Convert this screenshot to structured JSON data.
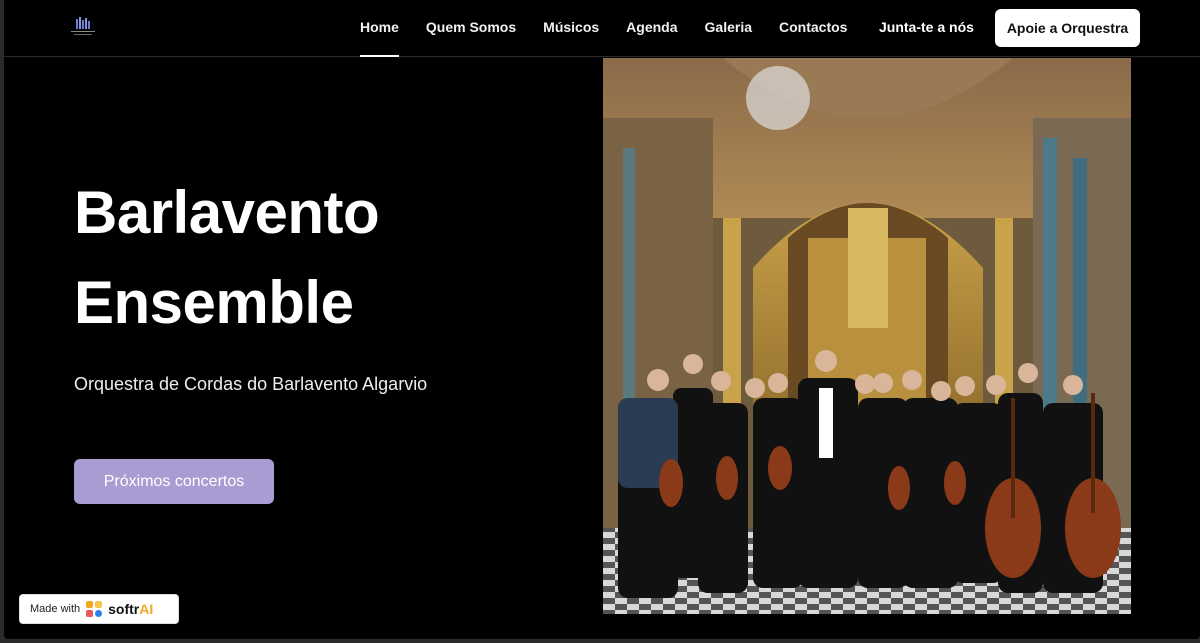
{
  "nav": {
    "items": [
      {
        "label": "Home",
        "active": true
      },
      {
        "label": "Quem Somos",
        "active": false
      },
      {
        "label": "Músicos",
        "active": false
      },
      {
        "label": "Agenda",
        "active": false
      },
      {
        "label": "Galeria",
        "active": false
      },
      {
        "label": "Contactos",
        "active": false
      }
    ],
    "join_label": "Junta-te a nós",
    "support_label": "Apoie a Orquestra"
  },
  "hero": {
    "title_line1": "Barlavento",
    "title_line2": "Ensemble",
    "subtitle": "Orquestra de Cordas do Barlavento Algarvio",
    "cta_label": "Próximos concertos",
    "cta_color": "#a99cd2"
  },
  "badge": {
    "made_with": "Made with",
    "brand": "softr",
    "brand_ai": "AI"
  },
  "icons": {
    "logo": "orchestra-logo-icon",
    "badge_logo": "softr-logo-icon"
  }
}
